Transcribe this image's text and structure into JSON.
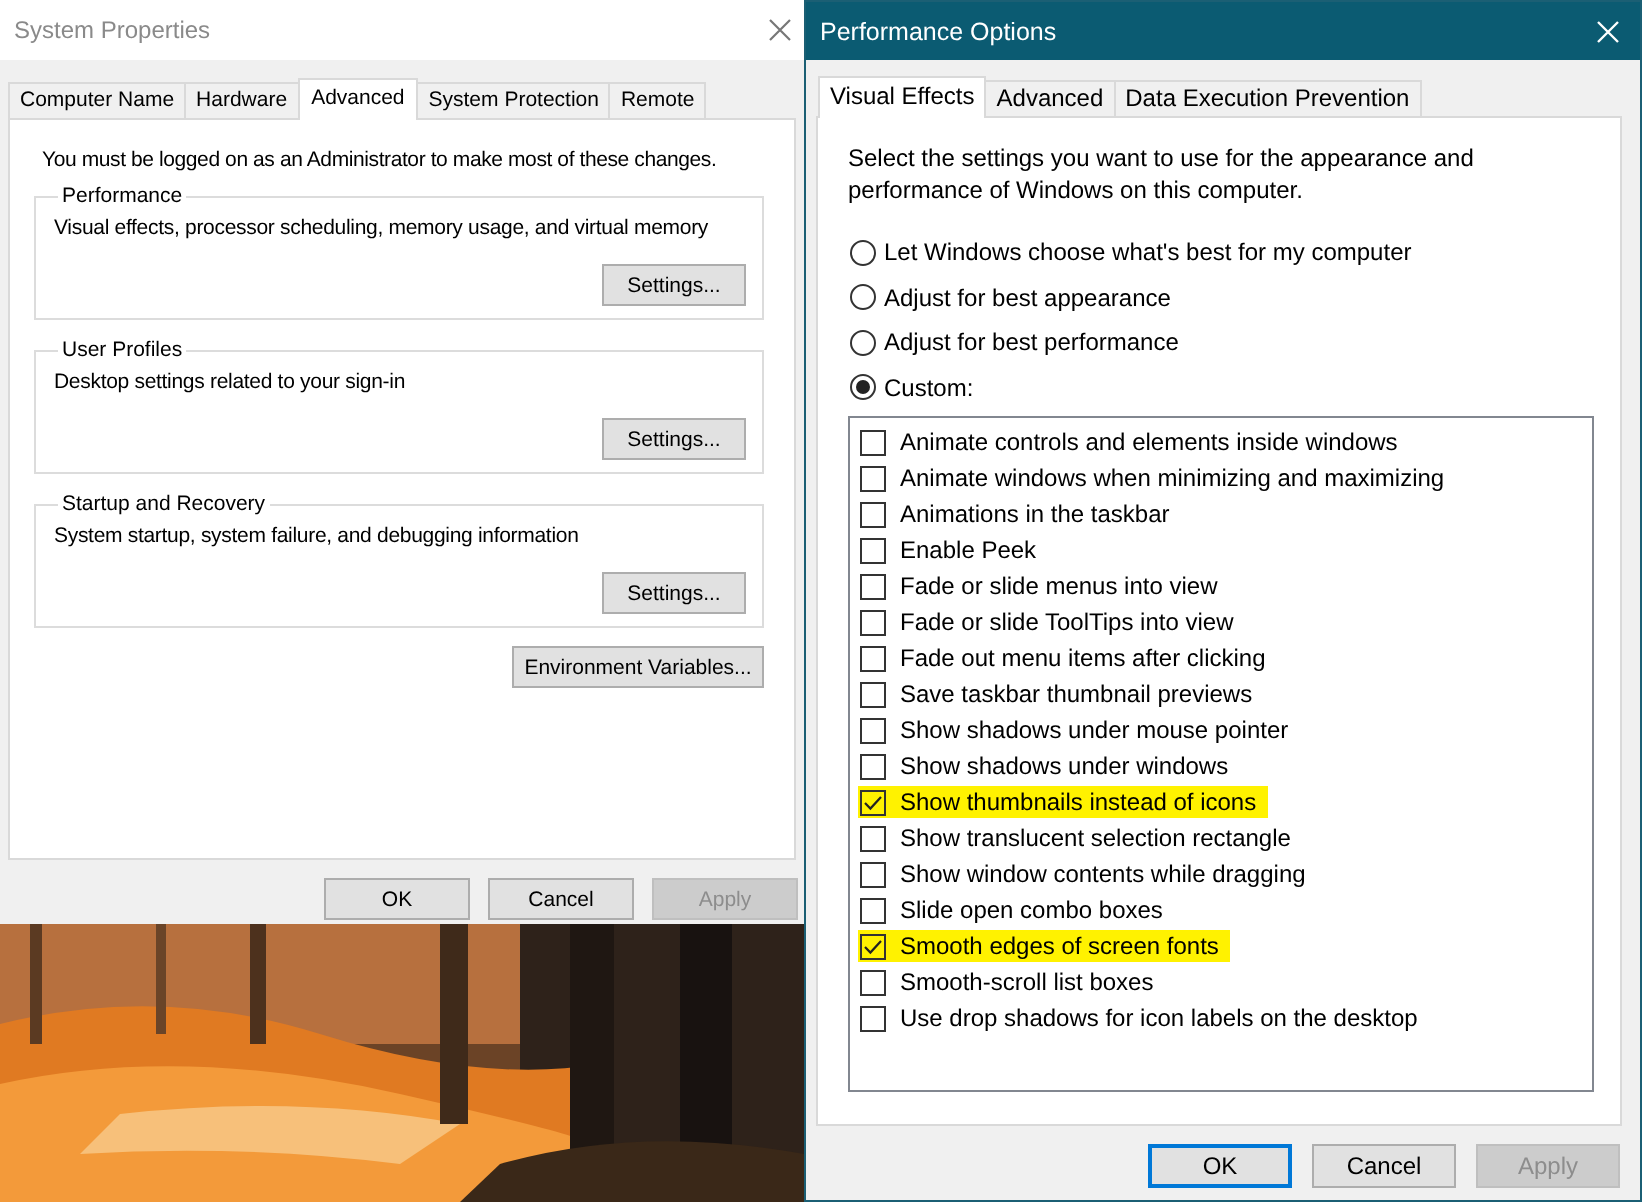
{
  "system_properties": {
    "title": "System Properties",
    "tabs": [
      {
        "label": "Computer Name",
        "selected": false
      },
      {
        "label": "Hardware",
        "selected": false
      },
      {
        "label": "Advanced",
        "selected": true
      },
      {
        "label": "System Protection",
        "selected": false
      },
      {
        "label": "Remote",
        "selected": false
      }
    ],
    "note": "You must be logged on as an Administrator to make most of these changes.",
    "groups": [
      {
        "title": "Performance",
        "description": "Visual effects, processor scheduling, memory usage, and virtual memory",
        "button": "Settings..."
      },
      {
        "title": "User Profiles",
        "description": "Desktop settings related to your sign-in",
        "button": "Settings..."
      },
      {
        "title": "Startup and Recovery",
        "description": "System startup, system failure, and debugging information",
        "button": "Settings..."
      }
    ],
    "environment_button": "Environment Variables...",
    "buttons": [
      {
        "label": "OK",
        "disabled": false
      },
      {
        "label": "Cancel",
        "disabled": false
      },
      {
        "label": "Apply",
        "disabled": true
      }
    ]
  },
  "performance_options": {
    "title": "Performance Options",
    "tabs": [
      {
        "label": "Visual Effects",
        "selected": true
      },
      {
        "label": "Advanced",
        "selected": false
      },
      {
        "label": "Data Execution Prevention",
        "selected": false
      }
    ],
    "description": "Select the settings you want to use for the appearance and performance of Windows on this computer.",
    "radios": [
      {
        "label": "Let Windows choose what's best for my computer",
        "selected": false
      },
      {
        "label": "Adjust for best appearance",
        "selected": false
      },
      {
        "label": "Adjust for best performance",
        "selected": false
      },
      {
        "label": "Custom:",
        "selected": true
      }
    ],
    "effects": [
      {
        "label": "Animate controls and elements inside windows",
        "checked": false,
        "highlighted": false
      },
      {
        "label": "Animate windows when minimizing and maximizing",
        "checked": false,
        "highlighted": false
      },
      {
        "label": "Animations in the taskbar",
        "checked": false,
        "highlighted": false
      },
      {
        "label": "Enable Peek",
        "checked": false,
        "highlighted": false
      },
      {
        "label": "Fade or slide menus into view",
        "checked": false,
        "highlighted": false
      },
      {
        "label": "Fade or slide ToolTips into view",
        "checked": false,
        "highlighted": false
      },
      {
        "label": "Fade out menu items after clicking",
        "checked": false,
        "highlighted": false
      },
      {
        "label": "Save taskbar thumbnail previews",
        "checked": false,
        "highlighted": false
      },
      {
        "label": "Show shadows under mouse pointer",
        "checked": false,
        "highlighted": false
      },
      {
        "label": "Show shadows under windows",
        "checked": false,
        "highlighted": false
      },
      {
        "label": "Show thumbnails instead of icons",
        "checked": true,
        "highlighted": true
      },
      {
        "label": "Show translucent selection rectangle",
        "checked": false,
        "highlighted": false
      },
      {
        "label": "Show window contents while dragging",
        "checked": false,
        "highlighted": false
      },
      {
        "label": "Slide open combo boxes",
        "checked": false,
        "highlighted": false
      },
      {
        "label": "Smooth edges of screen fonts",
        "checked": true,
        "highlighted": true
      },
      {
        "label": "Smooth-scroll list boxes",
        "checked": false,
        "highlighted": false
      },
      {
        "label": "Use drop shadows for icon labels on the desktop",
        "checked": false,
        "highlighted": false
      }
    ],
    "buttons": [
      {
        "label": "OK",
        "disabled": false,
        "focused": true
      },
      {
        "label": "Cancel",
        "disabled": false,
        "focused": false
      },
      {
        "label": "Apply",
        "disabled": true,
        "focused": false
      }
    ]
  }
}
